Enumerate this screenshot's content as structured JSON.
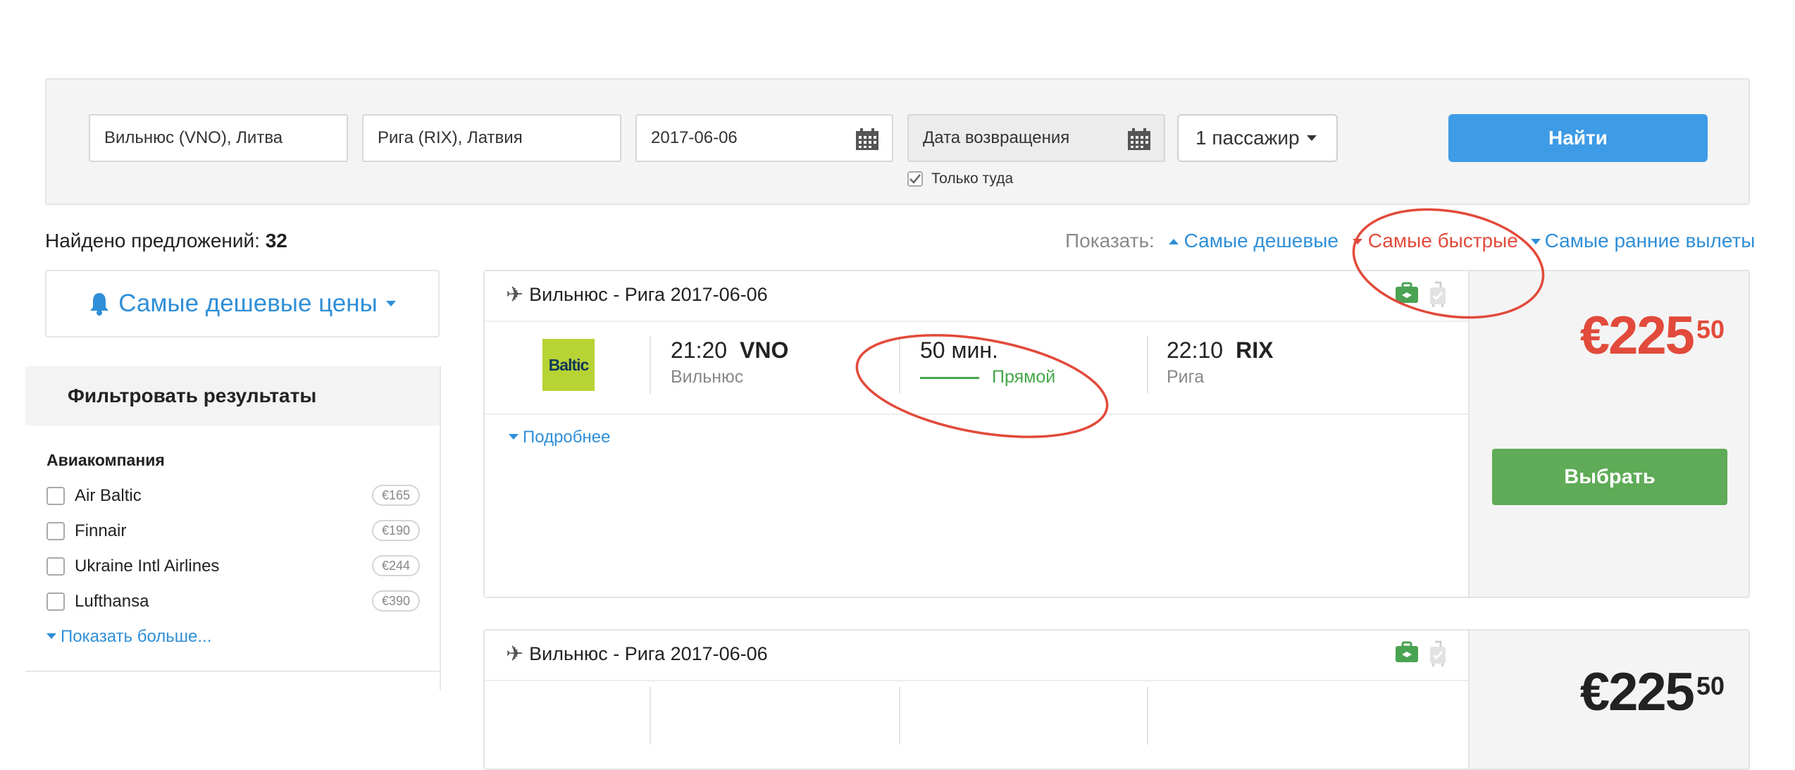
{
  "search": {
    "from": "Вильнюс (VNO), Литва",
    "to": "Рига (RIX), Латвия",
    "depart_date": "2017-06-06",
    "return_placeholder": "Дата возвращения",
    "passengers": "1 пассажир",
    "find_label": "Найти",
    "one_way_label": "Только туда",
    "one_way_checked": true
  },
  "results": {
    "found_label": "Найдено предложений:",
    "found_count": "32",
    "sort_label": "Показать:",
    "sort_cheapest": "Самые дешевые",
    "sort_fastest": "Самые быстрые",
    "sort_earliest": "Самые ранние вылеты",
    "active_sort": "fastest"
  },
  "sidebar": {
    "price_mode": "Самые дешевые цены",
    "filter_title": "Фильтровать результаты",
    "airline_title": "Авиакомпания",
    "airlines": [
      {
        "name": "Air Baltic",
        "price": "€165"
      },
      {
        "name": "Finnair",
        "price": "€190"
      },
      {
        "name": "Ukraine Intl Airlines",
        "price": "€244"
      },
      {
        "name": "Lufthansa",
        "price": "€390"
      }
    ],
    "show_more": "Показать больше..."
  },
  "offers": [
    {
      "route": "Вильнюс - Рига 2017-06-06",
      "logo_text": "Baltic",
      "depart_time": "21:20",
      "depart_code": "VNO",
      "depart_city": "Вильнюс",
      "duration": "50 мин.",
      "stops": "Прямой",
      "arrive_time": "22:10",
      "arrive_code": "RIX",
      "arrive_city": "Рига",
      "details": "Подробнее",
      "price_main": "€225",
      "price_cents": "50",
      "select_label": "Выбрать"
    },
    {
      "route": "Вильнюс - Рига 2017-06-06",
      "price_main": "€225",
      "price_cents": "50"
    }
  ],
  "colors": {
    "accent_blue": "#3e9be6",
    "link_blue": "#2f8fd8",
    "price_red": "#e24a3b",
    "select_green": "#5fab57",
    "direct_green": "#45a84a"
  }
}
